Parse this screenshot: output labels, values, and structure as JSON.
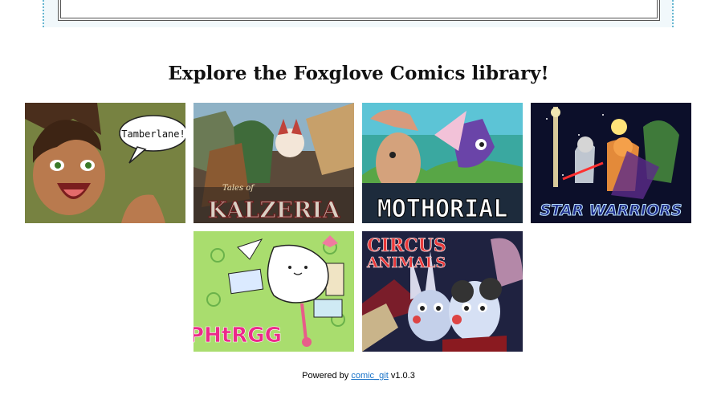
{
  "heading": "Explore the Foxglove Comics library!",
  "comics": [
    {
      "title": "Tamberlane",
      "speech": "Tamberlane!"
    },
    {
      "title": "Tales of Kalzeria",
      "small": "Tales of",
      "big": "KALZERIA"
    },
    {
      "title": "Mothorial",
      "big": "MOTHORIAL"
    },
    {
      "title": "Star Warriors",
      "big": "STAR WARRIORS"
    },
    {
      "title": "Phtrgg",
      "big": "PHtRGG"
    },
    {
      "title": "Circus Animals",
      "line1": "CIRCUS",
      "line2": "ANIMALS"
    }
  ],
  "footer": {
    "prefix": "Powered by",
    "link": "comic_git",
    "version": "v1.0.3"
  }
}
